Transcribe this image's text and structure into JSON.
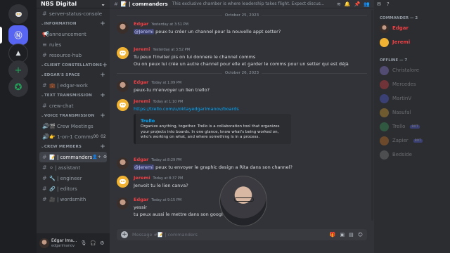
{
  "server": {
    "name": "NBS Digital",
    "chevron": "v"
  },
  "rail": {
    "servers": [
      "discord-home",
      "nbs-digital",
      "server-2",
      "server-3",
      "add-server",
      "explore"
    ]
  },
  "sidebar": {
    "top_channels": [
      {
        "label": "server-status-console"
      }
    ],
    "categories": [
      {
        "name": "INFORMATION",
        "channels": [
          {
            "label": "announcement",
            "icon": "megaphone"
          },
          {
            "label": "rules",
            "icon": "rules"
          },
          {
            "label": "resource-hub",
            "icon": "hash"
          }
        ]
      },
      {
        "name": "CLIENT CONSTELLATIONS",
        "channels": []
      },
      {
        "name": "EDGAR'S SPACE",
        "channels": [
          {
            "label": "💼 | edgar-work",
            "icon": "hash"
          }
        ]
      },
      {
        "name": "TEXT TRANSMISSION",
        "channels": [
          {
            "label": "crew-chat",
            "icon": "hash"
          }
        ]
      },
      {
        "name": "VOICE TRANSMISSION",
        "channels": [
          {
            "label": "🎬 Crew Meetings",
            "icon": "speaker"
          },
          {
            "label": "👉 1-on-1 Comms",
            "icon": "speaker",
            "badge_a": "00",
            "badge_b": "02"
          }
        ]
      },
      {
        "name": "CREW MEMBERS",
        "channels": [
          {
            "label": "📝 | commanders",
            "icon": "hash",
            "selected": true
          },
          {
            "label": "⚪ | assistant",
            "icon": "hash"
          },
          {
            "label": "🔧 | engineer",
            "icon": "hash"
          },
          {
            "label": "🔗 | editors",
            "icon": "hash"
          },
          {
            "label": "🎥 | wordsmith",
            "icon": "hash"
          }
        ]
      }
    ]
  },
  "user": {
    "name": "Edgar Ima...",
    "sub": "edgarimanov"
  },
  "chat": {
    "channel_title": "📝 | commanders",
    "topic": "This exclusive chamber is where leadership takes flight. Expect discus...",
    "dividers": [
      "October 25, 2023",
      "October 26, 2023"
    ],
    "messages": [
      {
        "author": "Edgar",
        "time": "Yesterday at 3:51 PM",
        "avatar": "edgar",
        "lines": [
          {
            "mention": "@Jeremi",
            "text": " peux-tu créer un channel pour la nouvelle appt setter?"
          }
        ]
      },
      {
        "author": "Jeremi",
        "time": "Yesterday at 3:52 PM",
        "avatar": "discord",
        "lines": [
          {
            "mention": "",
            "text": "Tu peux l'inviter pis on lui donnere le channel comms"
          },
          {
            "mention": "",
            "text": "Ou on peux lui crée un autre channel pour elle et garder le comms pour un setter qui est déjà"
          }
        ]
      },
      {
        "author": "Edgar",
        "time": "Today at 1:09 PM",
        "avatar": "edgar",
        "lines": [
          {
            "mention": "",
            "text": "peux-tu m'envoyer un lien trello?"
          }
        ]
      },
      {
        "author": "Jeremi",
        "time": "Today at 1:10 PM",
        "avatar": "discord",
        "lines": [
          {
            "mention": "",
            "text": "https://trello.com/u/oktayedgarimanov/boards",
            "link": true
          }
        ],
        "embed": {
          "title": "Trello",
          "desc": "Organize anything, together. Trello is a collaboration tool that organizes your projects into boards. In one glance, know what's being worked on, who's working on what, and where something is in a process."
        }
      },
      {
        "author": "Edgar",
        "time": "Today at 8:29 PM",
        "avatar": "edgar",
        "lines": [
          {
            "mention": "@Jeremi",
            "text": " peux tu envoyer le graphic design a Rita dans son channel?"
          }
        ]
      },
      {
        "author": "Jeremi",
        "time": "Today at 8:37 PM",
        "avatar": "discord",
        "lines": [
          {
            "mention": "",
            "text": "Jenvoit tu le lien canva?"
          }
        ]
      },
      {
        "author": "Edgar",
        "time": "Today at 9:15 PM",
        "avatar": "edgar",
        "lines": [
          {
            "mention": "",
            "text": "yessir"
          },
          {
            "mention": "",
            "text": "tu peux aussi le mettre dans son googl"
          }
        ]
      }
    ],
    "composer_placeholder": "Message #📝 | commanders"
  },
  "members": {
    "online_header": "COMMANDER — 2",
    "online": [
      {
        "name": "Edgar",
        "color": "#f23f43"
      },
      {
        "name": "Jeremi",
        "color": "#f23f43"
      }
    ],
    "offline_header": "OFFLINE — 7",
    "offline": [
      {
        "name": "Christalore"
      },
      {
        "name": "Mercedes"
      },
      {
        "name": "MartinV"
      },
      {
        "name": "Nasufal"
      },
      {
        "name": "Trello",
        "bot": "BOT"
      },
      {
        "name": "Zapier",
        "bot": "BOT"
      },
      {
        "name": "Bedside"
      }
    ]
  },
  "colors": {
    "accent": "#5865f2",
    "commander_red": "#f23f43",
    "link": "#00a8fc"
  }
}
